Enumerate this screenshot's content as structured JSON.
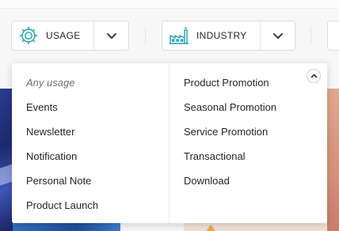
{
  "filters": {
    "usage": {
      "label": "USAGE",
      "icon": "gear-icon",
      "dropdown_icon": "chevron-down-icon"
    },
    "industry": {
      "label": "INDUSTRY",
      "icon": "factory-icon",
      "dropdown_icon": "chevron-down-icon"
    }
  },
  "dropdown": {
    "left_options": [
      {
        "label": "Any usage",
        "placeholder": true
      },
      {
        "label": "Events"
      },
      {
        "label": "Newsletter"
      },
      {
        "label": "Notification"
      },
      {
        "label": "Personal Note"
      },
      {
        "label": "Product Launch"
      }
    ],
    "right_options": [
      {
        "label": "Product Promotion"
      },
      {
        "label": "Seasonal Promotion"
      },
      {
        "label": "Service Promotion"
      },
      {
        "label": "Transactional"
      },
      {
        "label": "Download"
      }
    ],
    "collapse_icon": "chevron-up-icon"
  },
  "colors": {
    "accent": "#1a9fb5",
    "text": "#1f2326",
    "placeholder": "#6b6f74",
    "border": "#d9dbde"
  }
}
